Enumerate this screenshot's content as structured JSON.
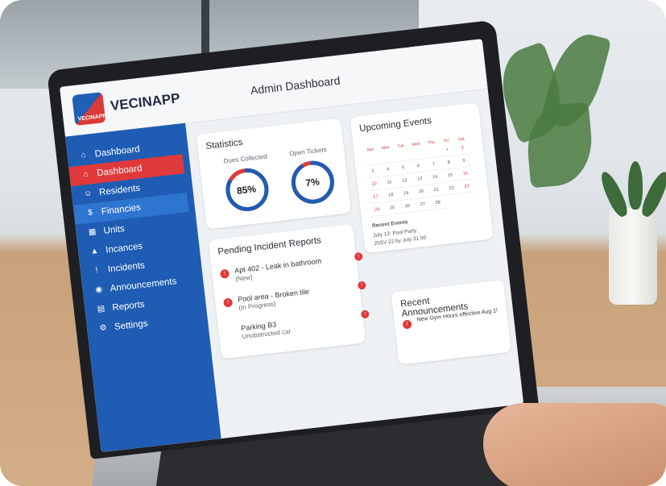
{
  "app": {
    "brand": "VECINAPP",
    "logo_text": "VECINAPP",
    "page_title": "Admin Dashboard"
  },
  "sidebar": {
    "items": [
      {
        "label": "Dashboard",
        "icon": "home-icon"
      },
      {
        "label": "Dashboard",
        "icon": "home-icon",
        "active": true
      },
      {
        "label": "Residents",
        "icon": "users-icon"
      },
      {
        "label": "Financies",
        "icon": "money-icon",
        "highlight": true
      },
      {
        "label": "Units",
        "icon": "building-icon"
      },
      {
        "label": "Incances",
        "icon": "warning-icon"
      },
      {
        "label": "Incidents",
        "icon": "alert-icon"
      },
      {
        "label": "Announcements",
        "icon": "megaphone-icon"
      },
      {
        "label": "Reports",
        "icon": "chart-icon"
      },
      {
        "label": "Settings",
        "icon": "gear-icon"
      }
    ]
  },
  "statistics": {
    "title": "Statistics",
    "dues": {
      "label": "Dues Collected",
      "value": "85%",
      "fraction": 0.85
    },
    "tickets": {
      "label": "Open Tickets",
      "value": "7%",
      "fraction": 0.07
    }
  },
  "events": {
    "title": "Upcoming Events",
    "weekdays": [
      "Sun",
      "Mon",
      "Tue",
      "Wed",
      "Thu",
      "Fri",
      "Sat"
    ],
    "days": [
      "",
      "",
      "",
      "",
      "",
      "•",
      "2",
      "3",
      "4",
      "5",
      "6",
      "7",
      "8",
      "9",
      "10",
      "11",
      "12",
      "13",
      "14",
      "15",
      "16",
      "17",
      "18",
      "19",
      "20",
      "21",
      "22",
      "23",
      "24",
      "25",
      "26",
      "27",
      "28"
    ],
    "heading": "Recent Events",
    "lines": [
      "July 13: Pool Party",
      "25SV 22 by July 31 00"
    ]
  },
  "incidents": {
    "title": "Pending Incident Reports",
    "items": [
      {
        "title": "Apt 402 - Leak in bathroom",
        "status": "(New)",
        "badge": "!"
      },
      {
        "title": "Pool area - Broken tile",
        "status": "(In Progress)",
        "badge": "!"
      },
      {
        "title": "Parking B3",
        "status": "Unobstructed car",
        "badge": "!"
      }
    ]
  },
  "announcements": {
    "title": "Recent Announcements",
    "items": [
      "New Gym Hours effective Aug 1!"
    ]
  },
  "colors": {
    "primary": "#1f5cb3",
    "accent": "#e0393b"
  }
}
